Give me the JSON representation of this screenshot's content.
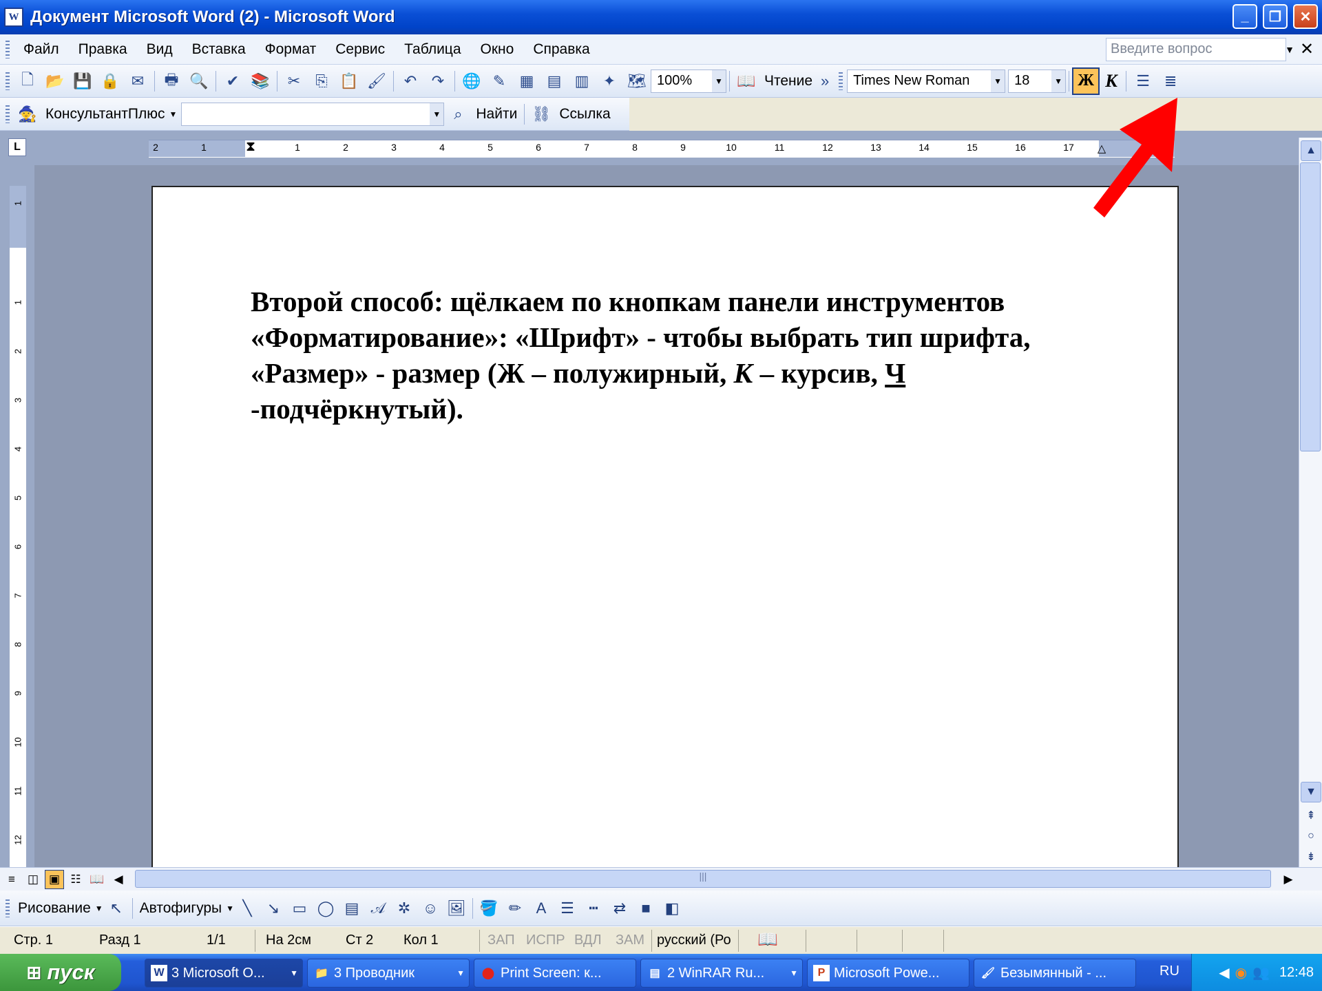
{
  "window": {
    "title": "Документ Microsoft Word (2) - Microsoft Word",
    "app_icon": "W"
  },
  "menu": {
    "items": [
      "Файл",
      "Правка",
      "Вид",
      "Вставка",
      "Формат",
      "Сервис",
      "Таблица",
      "Окно",
      "Справка"
    ],
    "ask_placeholder": "Введите вопрос"
  },
  "standard_toolbar": {
    "zoom": "100%",
    "reading_label": "Чтение"
  },
  "formatting_toolbar": {
    "font_name": "Times New Roman",
    "font_size": "18",
    "bold_label": "Ж",
    "italic_label": "К"
  },
  "consultant_toolbar": {
    "label": "КонсультантПлюс",
    "find_label": "Найти",
    "link_label": "Ссылка"
  },
  "ruler": {
    "corner": "L",
    "h_ticks": [
      "2",
      "1",
      "1",
      "2",
      "3",
      "4",
      "5",
      "6",
      "7",
      "8",
      "9",
      "10",
      "11",
      "12",
      "13",
      "14",
      "15",
      "16",
      "17"
    ],
    "v_ticks": [
      "1",
      "1",
      "2",
      "3",
      "4",
      "5",
      "6",
      "7",
      "8",
      "9",
      "10",
      "11",
      "12"
    ]
  },
  "document": {
    "para_part1": "Второй способ: щёлкаем по кнопкам панели инструментов «Форматирование»: «Шрифт» - чтобы выбрать тип шрифта, «Размер» - размер (Ж – полужирный, ",
    "italic_k": "К",
    "para_part2": " – курсив, ",
    "underline_ch": "Ч",
    "para_part3": " -подчёркнутый)."
  },
  "drawing_toolbar": {
    "drawing_label": "Рисование",
    "autoshapes_label": "Автофигуры"
  },
  "status_bar": {
    "page": "Стр. 1",
    "section": "Разд 1",
    "pages": "1/1",
    "at": "На 2см",
    "line": "Ст 2",
    "col": "Кол 1",
    "rec": "ЗАП",
    "trk": "ИСПР",
    "ext": "ВДЛ",
    "ovr": "ЗАМ",
    "language": "русский (Ро"
  },
  "taskbar": {
    "start_label": "пуск",
    "tasks": [
      "3 Microsoft O...",
      "3 Проводник",
      "Print Screen: к...",
      "2 WinRAR Ru...",
      "Microsoft Powe...",
      "Безымянный - ..."
    ],
    "lang": "RU",
    "clock": "12:48"
  },
  "colors": {
    "title_bar": "#0a4fd6",
    "bold_active": "#fcc35a",
    "arrow": "#ff0000"
  }
}
